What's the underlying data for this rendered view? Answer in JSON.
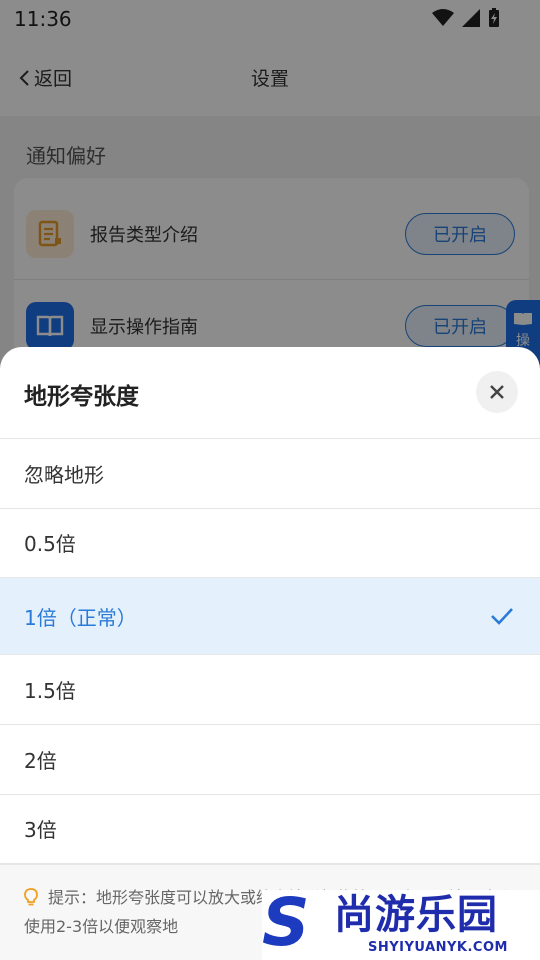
{
  "status_bar": {
    "time": "11:36"
  },
  "app_bar": {
    "back_label": "返回",
    "title": "设置"
  },
  "section": {
    "title": "通知偏好"
  },
  "settings_rows": [
    {
      "label": "报告类型介绍",
      "toggle": "已开启",
      "icon": "document-icon"
    },
    {
      "label": "显示操作指南",
      "toggle": "已开启",
      "icon": "book-icon"
    }
  ],
  "side_float": {
    "text": "操"
  },
  "sheet": {
    "title": "地形夸张度",
    "close_icon": "close-icon",
    "options": [
      {
        "label": "忽略地形",
        "selected": false
      },
      {
        "label": "0.5倍",
        "selected": false
      },
      {
        "label": "1倍（正常）",
        "selected": true
      },
      {
        "label": "1.5倍",
        "selected": false
      },
      {
        "label": "2倍",
        "selected": false
      },
      {
        "label": "3倍",
        "selected": false
      }
    ],
    "hint": {
      "icon": "lightbulb-icon",
      "text": "提示：地形夸张度可以放大或缩小地形起伏效果，山区可地区建议使用2-3倍以便观察地"
    }
  },
  "watermark": {
    "mark": "S",
    "brand": "尚游乐园",
    "domain": "SHYIYUANYK.COM"
  },
  "colors": {
    "accent": "#2a7bd8",
    "selected_bg": "#e4f0fb",
    "brand": "#1d3bbf"
  }
}
